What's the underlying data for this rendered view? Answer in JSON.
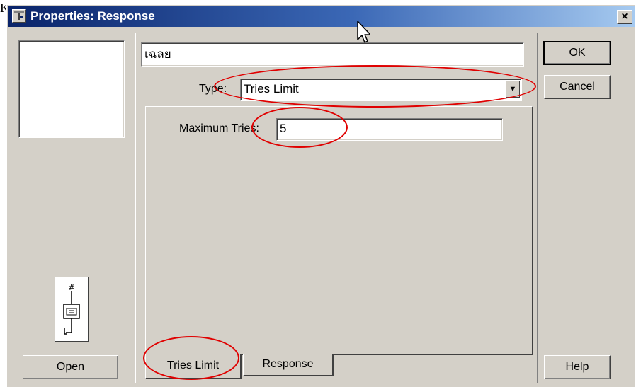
{
  "stray_char": "K",
  "window": {
    "title": "Properties: Response",
    "title_icon": "properties-icon",
    "close_glyph": "×"
  },
  "name_field": {
    "value": "เฉลย"
  },
  "type": {
    "label": "Type:",
    "selected": "Tries Limit"
  },
  "max_tries": {
    "label": "Maximum Tries:",
    "value": "5"
  },
  "buttons": {
    "ok": "OK",
    "cancel": "Cancel",
    "help": "Help",
    "open": "Open"
  },
  "tabs": [
    {
      "label": "Tries Limit",
      "active": true
    },
    {
      "label": "Response",
      "active": false
    }
  ],
  "flow_icon": {
    "symbol": "#"
  },
  "annotation_color": "#e00000"
}
